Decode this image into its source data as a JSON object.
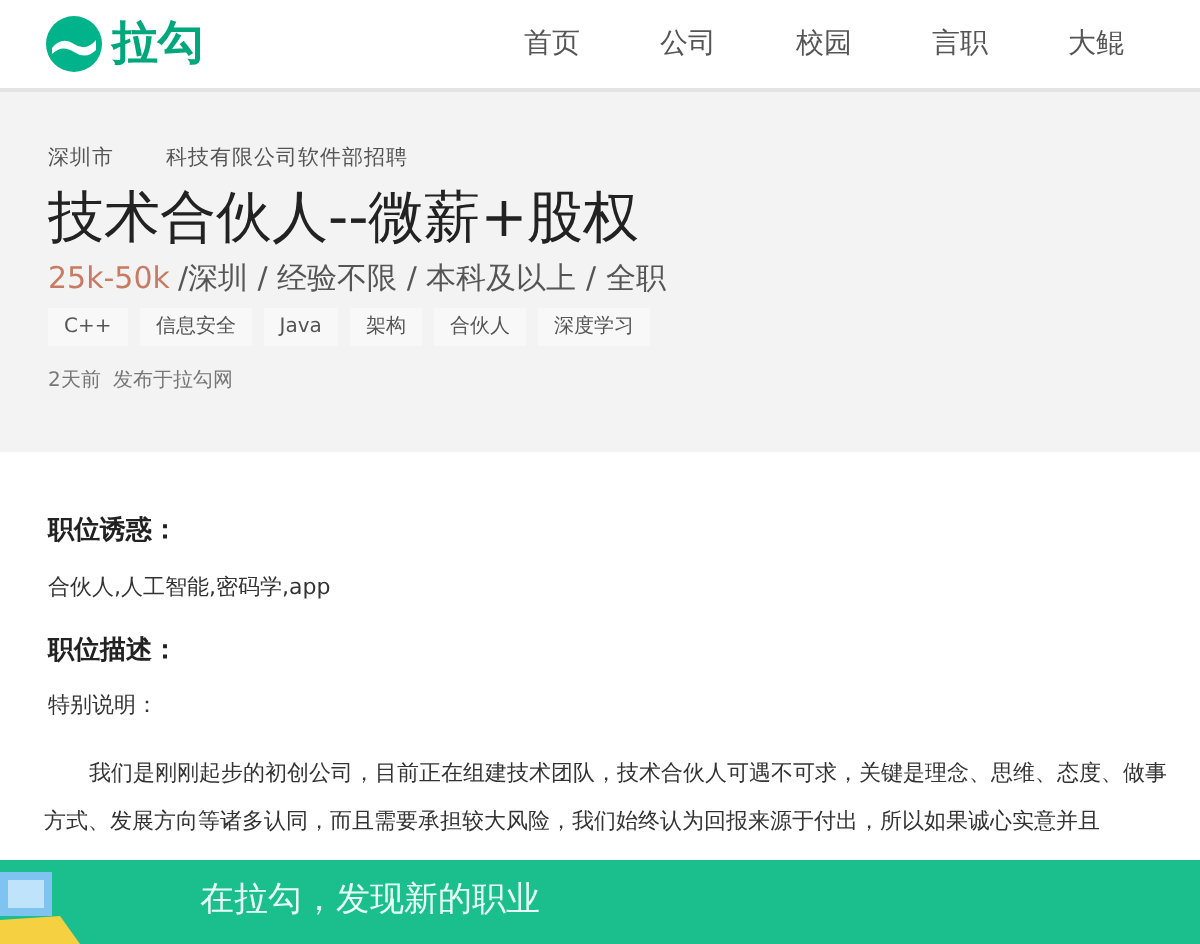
{
  "header": {
    "logo_text": "拉勾",
    "nav": [
      {
        "label": "首页"
      },
      {
        "label": "公司"
      },
      {
        "label": "校园"
      },
      {
        "label": "言职"
      },
      {
        "label": "大鲲"
      }
    ]
  },
  "job": {
    "city": "深圳市",
    "company": "科技有限公司软件部招聘",
    "title": "技术合伙人--微薪+股权",
    "salary": "25k-50k",
    "requirements": "/深圳 / 经验不限 / 本科及以上 / 全职",
    "tags": [
      "C++",
      "信息安全",
      "Java",
      "架构",
      "合伙人",
      "深度学习"
    ],
    "posted": "2天前  发布于拉勾网"
  },
  "sections": [
    {
      "heading": "职位诱惑：",
      "paragraphs": [
        {
          "kind": "plain",
          "text": "合伙人,人工智能,密码学,app"
        }
      ]
    },
    {
      "heading": "职位描述：",
      "paragraphs": [
        {
          "kind": "plain",
          "text": "特别说明："
        },
        {
          "kind": "indented",
          "text": "我们是刚刚起步的初创公司，目前正在组建技术团队，技术合伙人可遇不可求，关键是理念、思维、态度、做事方式、发展方向等诸多认同，而且需要承担较大风险，我们始终认为回报来源于付出，所以如果诚心实意并且"
        }
      ]
    }
  ],
  "banner": {
    "text": "在拉勾，发现新的职业"
  }
}
